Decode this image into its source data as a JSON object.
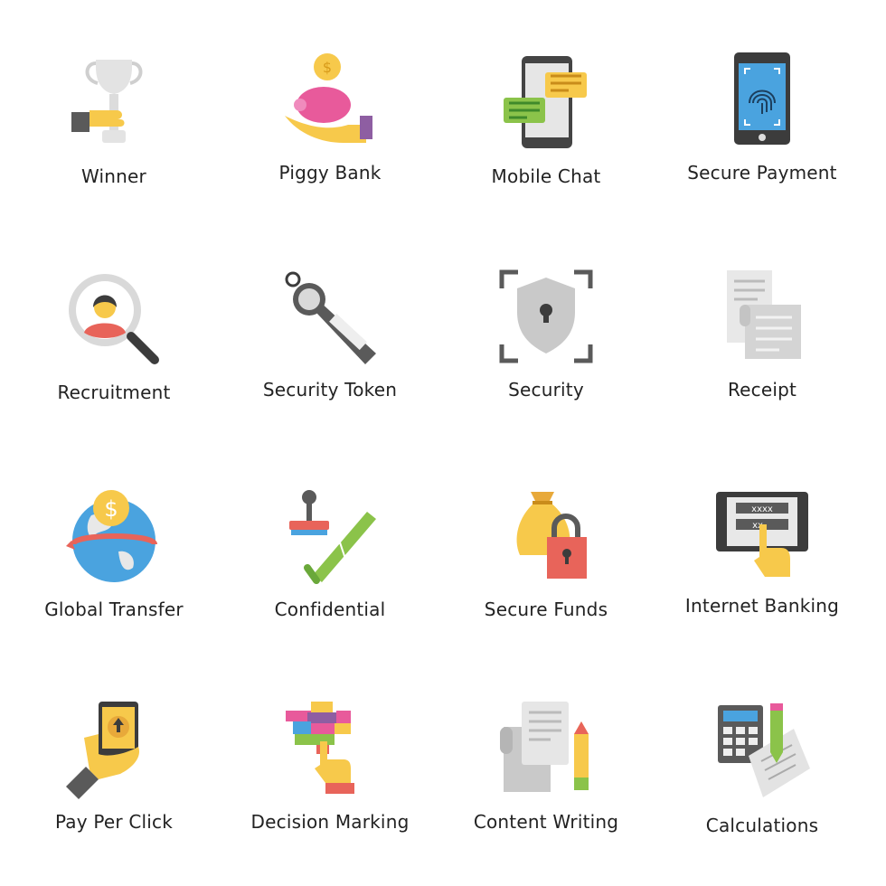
{
  "icons": [
    {
      "label": "Winner",
      "icon": "trophy-icon"
    },
    {
      "label": "Piggy Bank",
      "icon": "piggy-bank-icon"
    },
    {
      "label": "Mobile Chat",
      "icon": "mobile-chat-icon"
    },
    {
      "label": "Secure Payment",
      "icon": "fingerprint-phone-icon"
    },
    {
      "label": "Recruitment",
      "icon": "magnifier-person-icon"
    },
    {
      "label": "Security Token",
      "icon": "security-token-icon"
    },
    {
      "label": "Security",
      "icon": "shield-lock-icon"
    },
    {
      "label": "Receipt",
      "icon": "receipt-icon"
    },
    {
      "label": "Global Transfer",
      "icon": "globe-dollar-icon"
    },
    {
      "label": "Confidential",
      "icon": "stamp-scroll-icon"
    },
    {
      "label": "Secure Funds",
      "icon": "money-bag-lock-icon"
    },
    {
      "label": "Internet Banking",
      "icon": "tablet-password-icon"
    },
    {
      "label": "Pay Per Click",
      "icon": "hand-phone-click-icon"
    },
    {
      "label": "Decision Marking",
      "icon": "puzzle-hand-icon"
    },
    {
      "label": "Content Writing",
      "icon": "document-pencil-icon"
    },
    {
      "label": "Calculations",
      "icon": "calculator-pencil-icon"
    }
  ],
  "colors": {
    "gray": "#5a5a5a",
    "light_gray": "#d9d9d9",
    "yellow": "#f7c94b",
    "pink": "#e85a9b",
    "blue": "#4aa3df",
    "red": "#e8645a",
    "green": "#8bc34a"
  }
}
